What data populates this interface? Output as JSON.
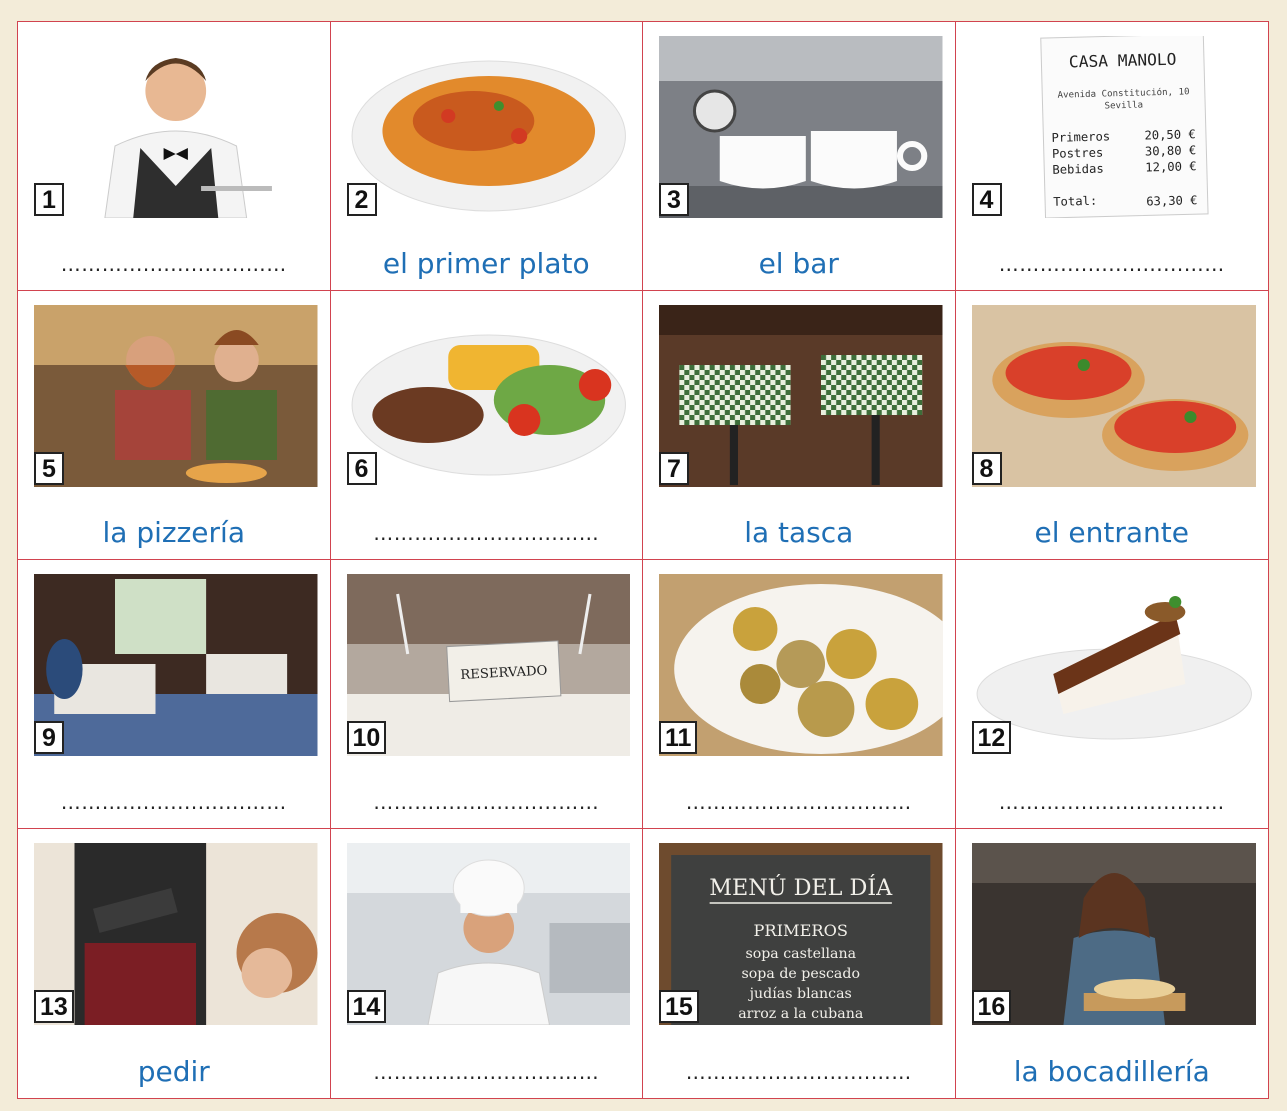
{
  "dots": "………..................……",
  "receipt": {
    "name": "CASA MANOLO",
    "address_line1": "Avenida Constitución, 10",
    "address_line2": "Sevilla",
    "rows": [
      {
        "label": "Primeros",
        "amount": "20,50 €"
      },
      {
        "label": "Postres",
        "amount": "30,80 €"
      },
      {
        "label": "Bebidas",
        "amount": "12,00 €"
      }
    ],
    "total_label": "Total:",
    "total_amount": "63,30 €"
  },
  "reserved_sign": "RESERVADO",
  "menu_board": {
    "title": "MENÚ DEL DÍA",
    "section": "PRIMEROS",
    "items": [
      "sopa castellana",
      "sopa de pescado",
      "judías blancas",
      "arroz a la cubana"
    ]
  },
  "cards": [
    {
      "number": "1",
      "caption": ""
    },
    {
      "number": "2",
      "caption": "el primer plato"
    },
    {
      "number": "3",
      "caption": "el bar"
    },
    {
      "number": "4",
      "caption": ""
    },
    {
      "number": "5",
      "caption": "la pizzería"
    },
    {
      "number": "6",
      "caption": ""
    },
    {
      "number": "7",
      "caption": "la tasca"
    },
    {
      "number": "8",
      "caption": "el entrante"
    },
    {
      "number": "9",
      "caption": ""
    },
    {
      "number": "10",
      "caption": ""
    },
    {
      "number": "11",
      "caption": ""
    },
    {
      "number": "12",
      "caption": ""
    },
    {
      "number": "13",
      "caption": "pedir"
    },
    {
      "number": "14",
      "caption": ""
    },
    {
      "number": "15",
      "caption": ""
    },
    {
      "number": "16",
      "caption": "la bocadillería"
    }
  ]
}
